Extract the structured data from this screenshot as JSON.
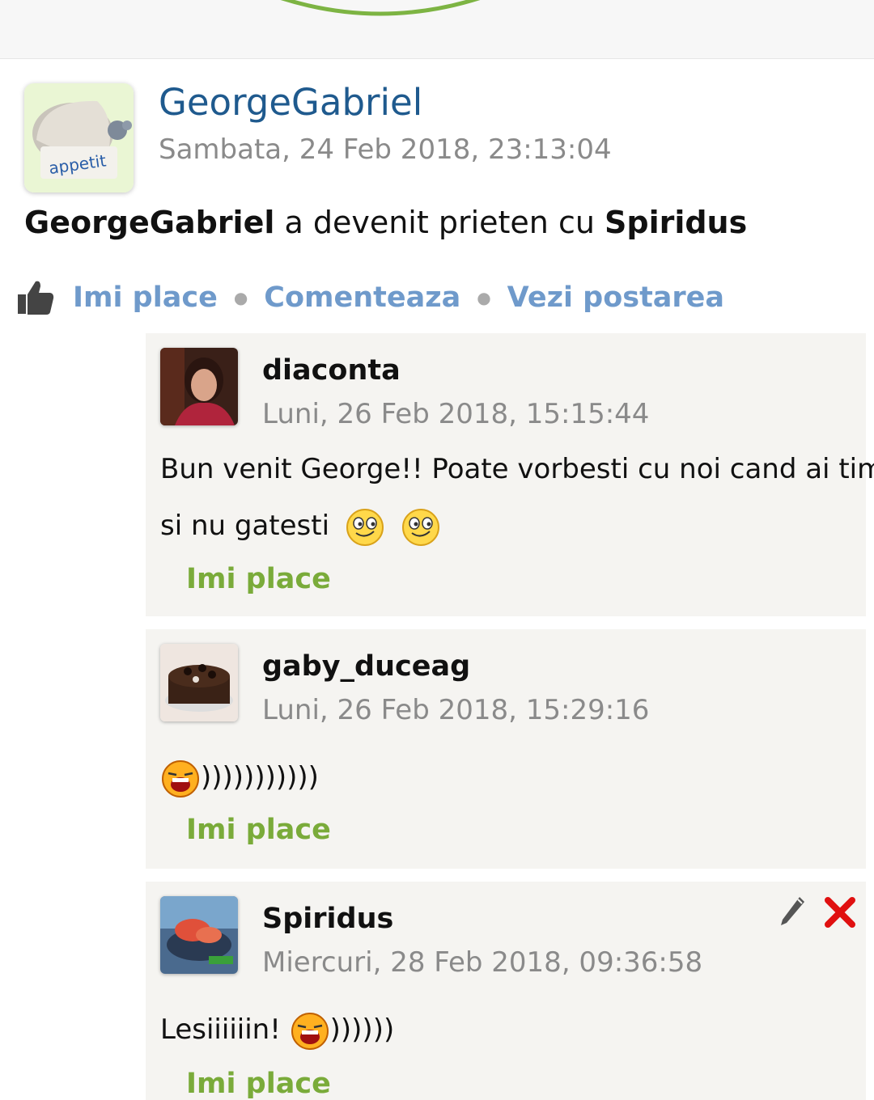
{
  "post": {
    "author": "GeorgeGabriel",
    "timestamp": "Sambata, 24 Feb 2018, 23:13:04",
    "activity": {
      "subject": "GeorgeGabriel",
      "verb": " a devenit prieten cu ",
      "object": "Spiridus"
    },
    "avatar_text": "bon appetit"
  },
  "actions": {
    "like": "Imi place",
    "comment": "Comenteaza",
    "view": "Vezi postarea"
  },
  "comments": [
    {
      "author": "diaconta",
      "timestamp": "Luni, 26 Feb 2018, 15:15:44",
      "text_line1": "Bun venit George!! Poate vorbesti cu noi cand ai timp",
      "text_line2": "si nu gatesti",
      "like": "Imi place"
    },
    {
      "author": "gaby_duceag",
      "timestamp": "Luni, 26 Feb 2018, 15:29:16",
      "text": ")))))))))))",
      "like": "Imi place"
    },
    {
      "author": "Spiridus",
      "timestamp": "Miercuri, 28 Feb 2018, 09:36:58",
      "text_before": "Lesiiiiiin! ",
      "text_after": "))))))",
      "like": "Imi place"
    }
  ],
  "colors": {
    "author_link": "#1f5a8e",
    "action_link": "#6f9acb",
    "like_green": "#7aab3a",
    "comment_bg": "#f5f4f1",
    "delete_red": "#e01010"
  }
}
